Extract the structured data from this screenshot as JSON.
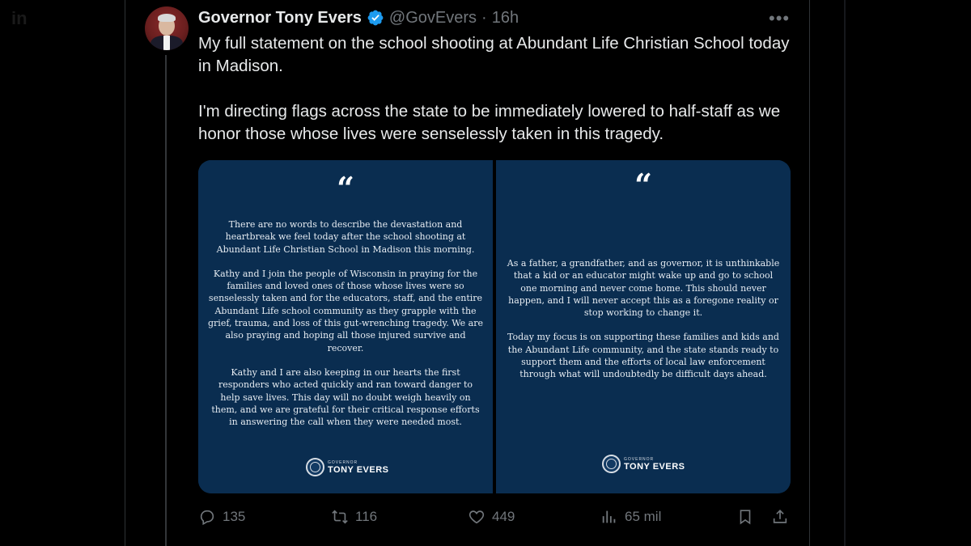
{
  "tweet": {
    "author_name": "Governor Tony Evers",
    "handle": "@GovEvers",
    "separator": "·",
    "time": "16h",
    "more_label": "•••",
    "text_paragraphs": [
      "My full statement on the school shooting at Abundant Life Christian School today in Madison.",
      "I'm directing flags across the state to be immediately lowered to half-staff as we honor those whose lives were senselessly taken in this tragedy."
    ]
  },
  "statement_image": {
    "quote_symbol": "“",
    "left_paragraphs": [
      "There are no words to describe the devastation and heartbreak we feel today after the school shooting at Abundant Life Christian School in Madison this morning.",
      "Kathy and I join the people of Wisconsin in praying for the families and loved ones of those whose lives were so senselessly taken and for the educators, staff, and the entire Abundant Life school community as they grapple with the grief, trauma, and loss of this gut-wrenching tragedy. We are also praying and hoping all those injured survive and recover.",
      "Kathy and I are also keeping in our hearts the first responders who acted quickly and ran toward danger to help save lives. This day will no doubt weigh heavily on them, and we are grateful for their critical response efforts in answering the call when they were needed most."
    ],
    "right_paragraphs": [
      "As a father, a grandfather, and as governor, it is unthinkable that a kid or an educator might wake up and go to school one morning and never come home. This should never happen, and I will never accept this as a foregone reality or stop working to change it.",
      "Today my focus is on supporting these families and kids and the Abundant Life community, and the state stands ready to support them and the efforts of local law enforcement through what will undoubtedly be difficult days ahead."
    ],
    "logo_small": "GOVERNOR",
    "logo_big": "TONY EVERS"
  },
  "actions": {
    "replies": "135",
    "reposts": "116",
    "likes": "449",
    "views": "65 mil"
  },
  "colors": {
    "background": "#000000",
    "text": "#e7e9ea",
    "muted": "#71767b",
    "verified": "#1d9bf0",
    "card_navy": "#0a2d50"
  }
}
